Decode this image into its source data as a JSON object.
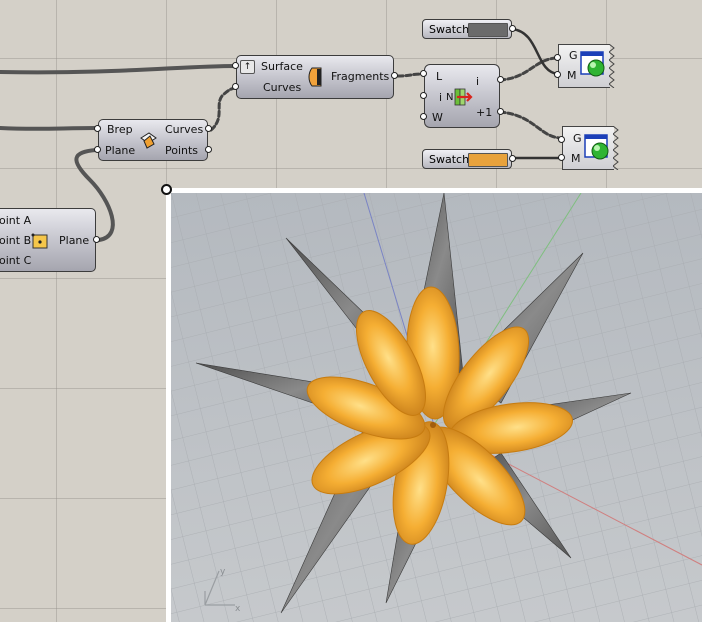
{
  "components": {
    "surface_split": {
      "inputs": [
        "Surface",
        "Curves"
      ],
      "output": "Fragments"
    },
    "brep_plane": {
      "inputs": [
        "Brep",
        "Plane"
      ],
      "outputs": [
        "Curves",
        "Points"
      ]
    },
    "plane_3pt": {
      "inputs": [
        "oint A",
        "oint B",
        "oint C"
      ],
      "output": "Plane"
    },
    "list_item": {
      "inputs": [
        "L",
        "i",
        "W"
      ],
      "center": "N",
      "outputs": [
        "i",
        "+1"
      ]
    },
    "preview_top": {
      "inputs": [
        "G",
        "M"
      ]
    },
    "preview_bottom": {
      "inputs": [
        "G",
        "M"
      ]
    }
  },
  "swatches": [
    {
      "label": "Swatch",
      "color": "#6b6b6b"
    },
    {
      "label": "Swatch",
      "color": "#e8a23c"
    }
  ],
  "viewport": {
    "background": "#bcc0c4",
    "shape_color": "#f0a52c",
    "spike_color": "#6a6a6a",
    "axis_labels": {
      "x": "x",
      "y": "y"
    }
  }
}
